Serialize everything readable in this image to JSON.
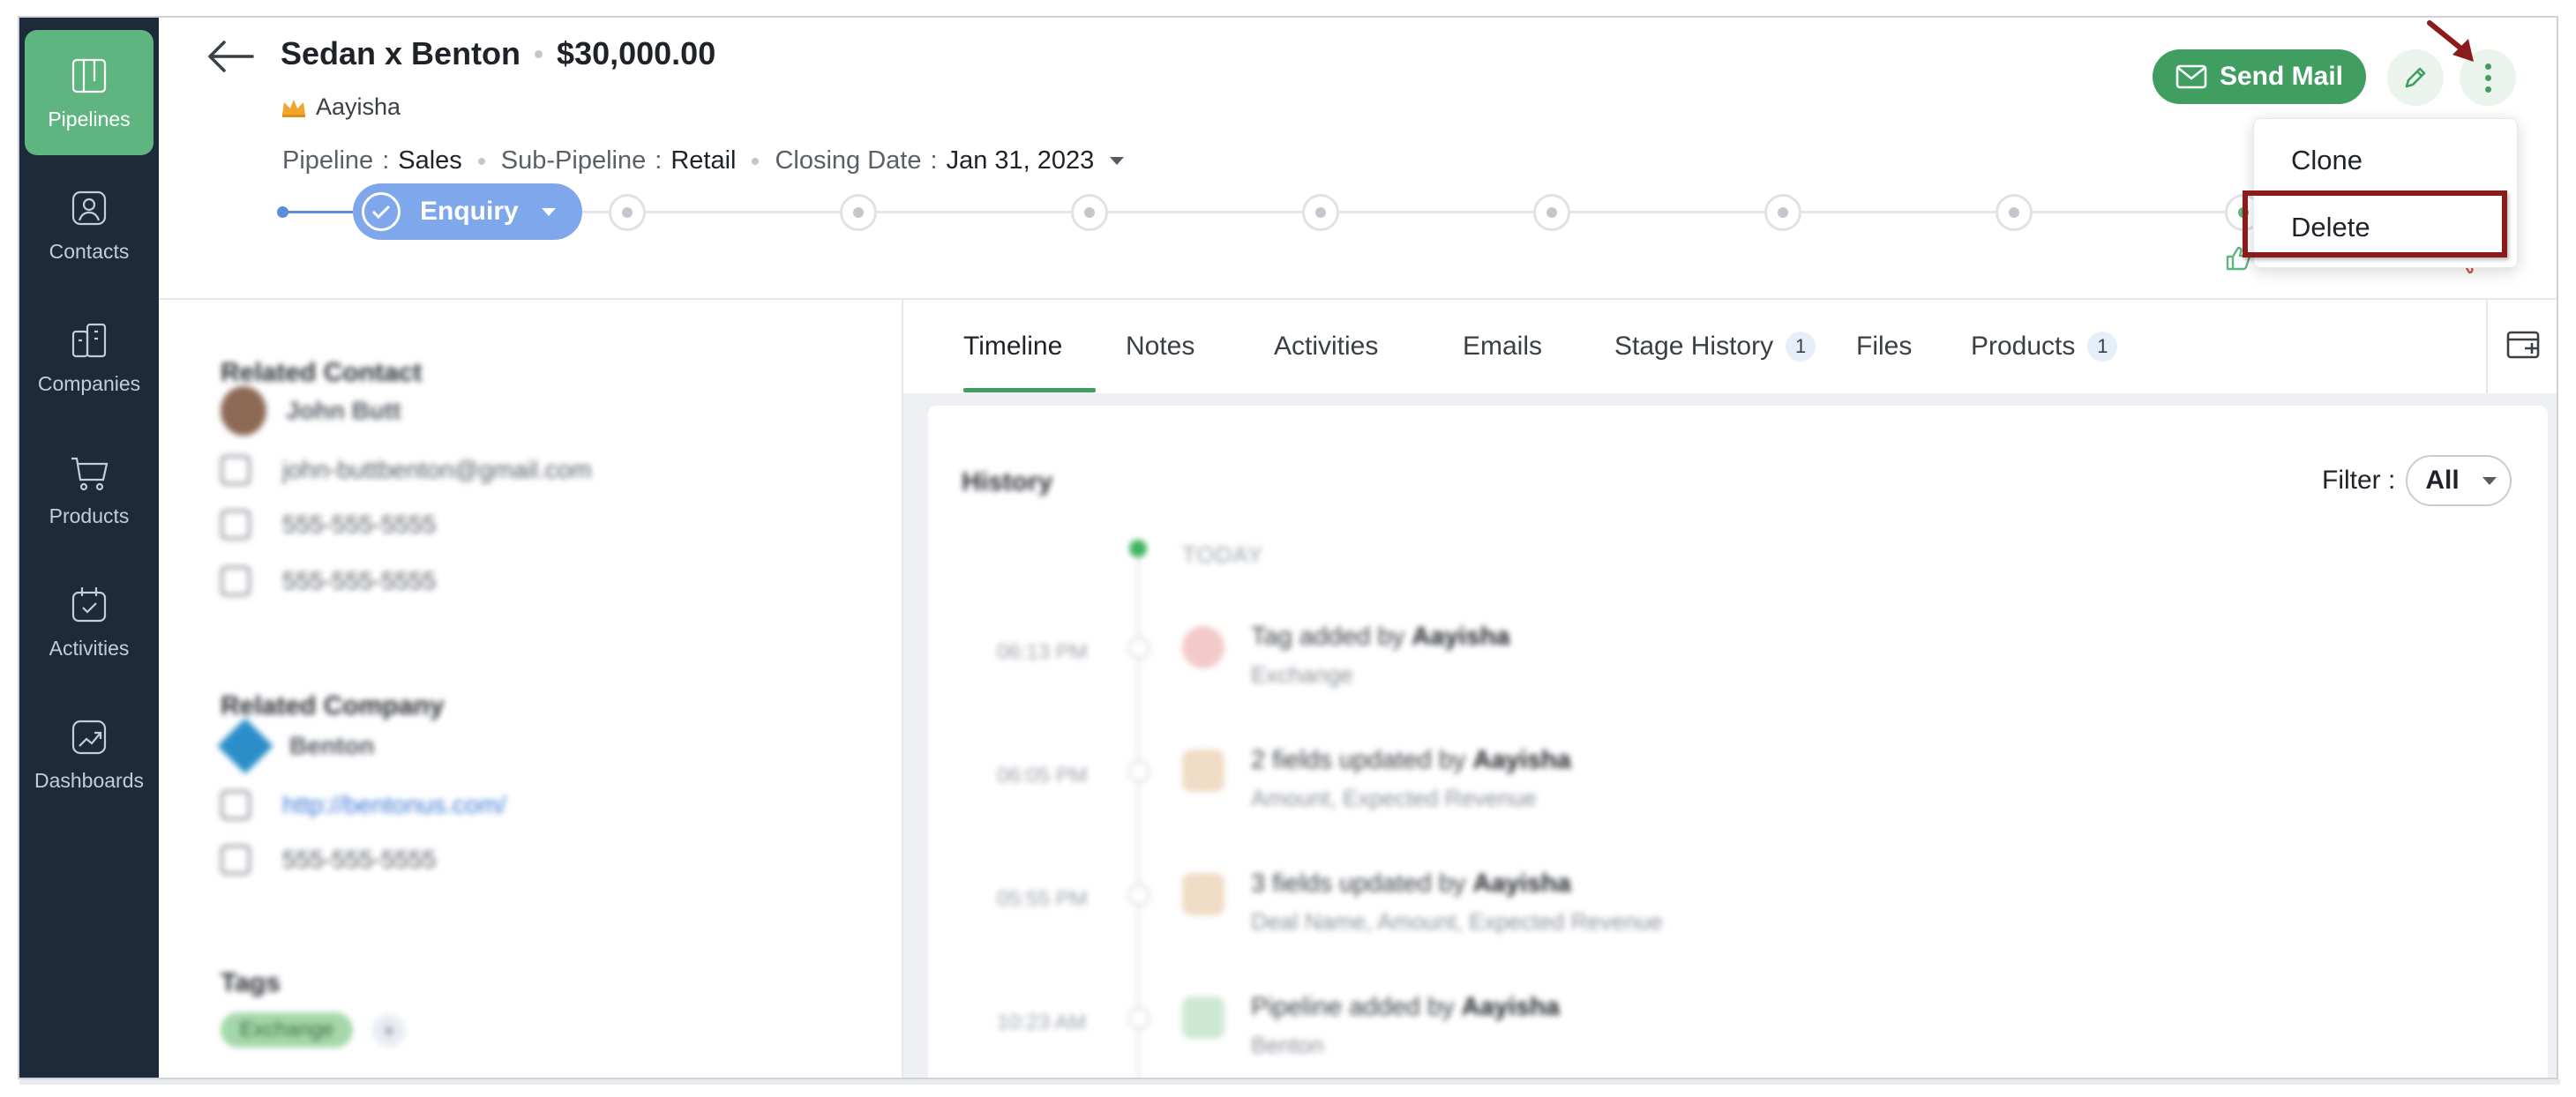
{
  "sidebar": {
    "items": [
      {
        "label": "Pipelines",
        "icon": "pipelines-icon",
        "active": true
      },
      {
        "label": "Contacts",
        "icon": "contacts-icon",
        "active": false
      },
      {
        "label": "Companies",
        "icon": "companies-icon",
        "active": false
      },
      {
        "label": "Products",
        "icon": "products-icon",
        "active": false
      },
      {
        "label": "Activities",
        "icon": "activities-icon",
        "active": false
      },
      {
        "label": "Dashboards",
        "icon": "dashboards-icon",
        "active": false
      }
    ]
  },
  "deal": {
    "name": "Sedan x Benton",
    "amount": "$30,000.00",
    "owner": "Aayisha",
    "pipeline_label": "Pipeline",
    "pipeline_value": "Sales",
    "subpipeline_label": "Sub-Pipeline",
    "subpipeline_value": "Retail",
    "closing_label": "Closing Date",
    "closing_value": "Jan 31, 2023",
    "colon": ":"
  },
  "stages": {
    "current": "Enquiry",
    "remaining_count": 9
  },
  "actions": {
    "send_mail": "Send Mail"
  },
  "more_menu": {
    "items": [
      "Clone",
      "Delete"
    ],
    "highlighted": "Delete"
  },
  "left_panel": {
    "related_contact": "Related Contact",
    "contact_name": "John Butt",
    "contact_email": "john-buttbenton@gmail.com",
    "contact_mobile": "555-555-5555",
    "contact_phone": "555-555-5555",
    "related_company": "Related Company",
    "company_name": "Benton",
    "company_url": "http://bentonus.com/",
    "company_phone": "555-555-5555",
    "tags_heading": "Tags",
    "tag": "Exchange",
    "tag_add": "+"
  },
  "tabs": [
    {
      "label": "Timeline",
      "badge": ""
    },
    {
      "label": "Notes",
      "badge": ""
    },
    {
      "label": "Activities",
      "badge": ""
    },
    {
      "label": "Emails",
      "badge": ""
    },
    {
      "label": "Stage History",
      "badge": "1"
    },
    {
      "label": "Files",
      "badge": ""
    },
    {
      "label": "Products",
      "badge": "1"
    }
  ],
  "history": {
    "heading": "History",
    "filter_label": "Filter :",
    "filter_value": "All",
    "today": "TODAY",
    "entries": [
      {
        "time": "06:13 PM",
        "text": "Tag added by",
        "by": "Aayisha",
        "detail": "Exchange"
      },
      {
        "time": "06:05 PM",
        "text": "2 fields updated by",
        "by": "Aayisha",
        "detail": "Amount, Expected Revenue"
      },
      {
        "time": "05:55 PM",
        "text": "3 fields updated by",
        "by": "Aayisha",
        "detail": "Deal Name, Amount, Expected Revenue"
      },
      {
        "time": "10:23 AM",
        "text": "Pipeline added by",
        "by": "Aayisha",
        "detail": "Benton"
      }
    ]
  },
  "colors": {
    "sidebar_bg": "#1c2a3a",
    "accent_green": "#3f9e60",
    "stage_blue": "#7fa7ec",
    "highlight_red": "#8a1c1c"
  }
}
